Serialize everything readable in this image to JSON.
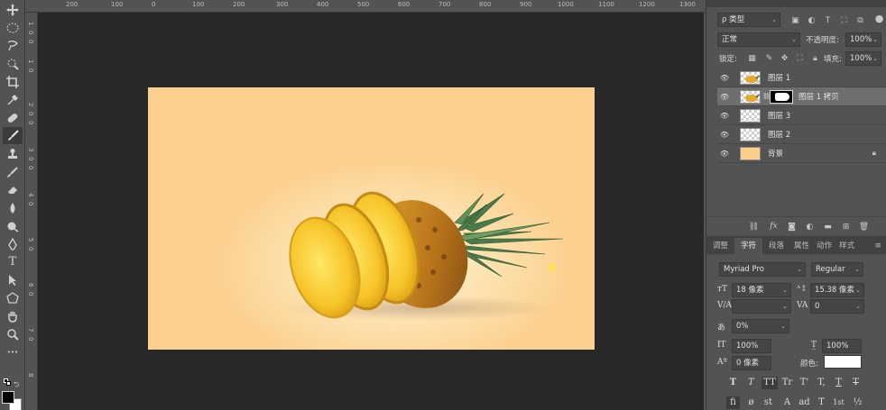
{
  "ruler": {
    "top_ticks": [
      "200",
      "100",
      "0",
      "100",
      "200",
      "300",
      "400",
      "500",
      "600",
      "700",
      "800",
      "900",
      "1000",
      "1100",
      "1200",
      "1300"
    ],
    "left_ticks": [
      "1",
      "0",
      "0",
      "1",
      "0",
      "2",
      "0",
      "0",
      "3",
      "0",
      "0",
      "4",
      "0",
      "5",
      "0",
      "6",
      "0",
      "7",
      "0",
      "8"
    ]
  },
  "toolbar": {
    "tools": [
      "move-icon",
      "marquee-icon",
      "lasso-icon",
      "quick-select-icon",
      "crop-icon",
      "eyedropper-icon",
      "healing-icon",
      "brush-icon",
      "stamp-icon",
      "history-brush-icon",
      "eraser-icon",
      "blur-icon",
      "dodge-icon",
      "pen-icon",
      "type-icon",
      "path-select-icon",
      "shape-icon",
      "hand-icon",
      "zoom-icon",
      "more-icon"
    ],
    "type_glyph": "T",
    "more_glyph": "•••"
  },
  "layers_panel": {
    "filter_label": "ρ 类型",
    "blend_mode": "正常",
    "opacity_label": "不透明度:",
    "opacity_value": "100%",
    "lock_label": "锁定:",
    "fill_label": "填充:",
    "fill_value": "100%",
    "layers": [
      {
        "name": "图层 1",
        "selected": false,
        "thumb": "pineapple"
      },
      {
        "name": "图层 1 拷贝",
        "selected": true,
        "thumb": "pineapple-mask"
      },
      {
        "name": "图层 3",
        "selected": false,
        "thumb": "transparent"
      },
      {
        "name": "图层 2",
        "selected": false,
        "thumb": "transparent"
      },
      {
        "name": "背景",
        "selected": false,
        "thumb": "background",
        "locked": true
      }
    ]
  },
  "char_panel": {
    "tabs": [
      "调整",
      "字符",
      "段落",
      "属性",
      "动作",
      "样式"
    ],
    "active_tab": "字符",
    "font_family": "Myriad Pro",
    "font_style": "Regular",
    "font_size": "18 像素",
    "leading": "15.38 像素",
    "kerning": "",
    "tracking": "0",
    "tsume": "0%",
    "vscale": "100%",
    "hscale": "100%",
    "baseline": "0 像素",
    "color_label": "颜色:",
    "color_value": "#ffffff",
    "style_buttons": [
      "T",
      "T",
      "TT",
      "Tr",
      "T'",
      "T,",
      "T",
      "T"
    ],
    "bottom_glyphs": [
      "fi",
      "ø",
      "st",
      "A",
      "ad",
      "T",
      "1st",
      "½"
    ]
  },
  "colors": {
    "canvas_bg": "#fcd08e",
    "workspace": "#282828",
    "panel": "#535353",
    "foreground": "#000000",
    "background": "#ffffff"
  }
}
